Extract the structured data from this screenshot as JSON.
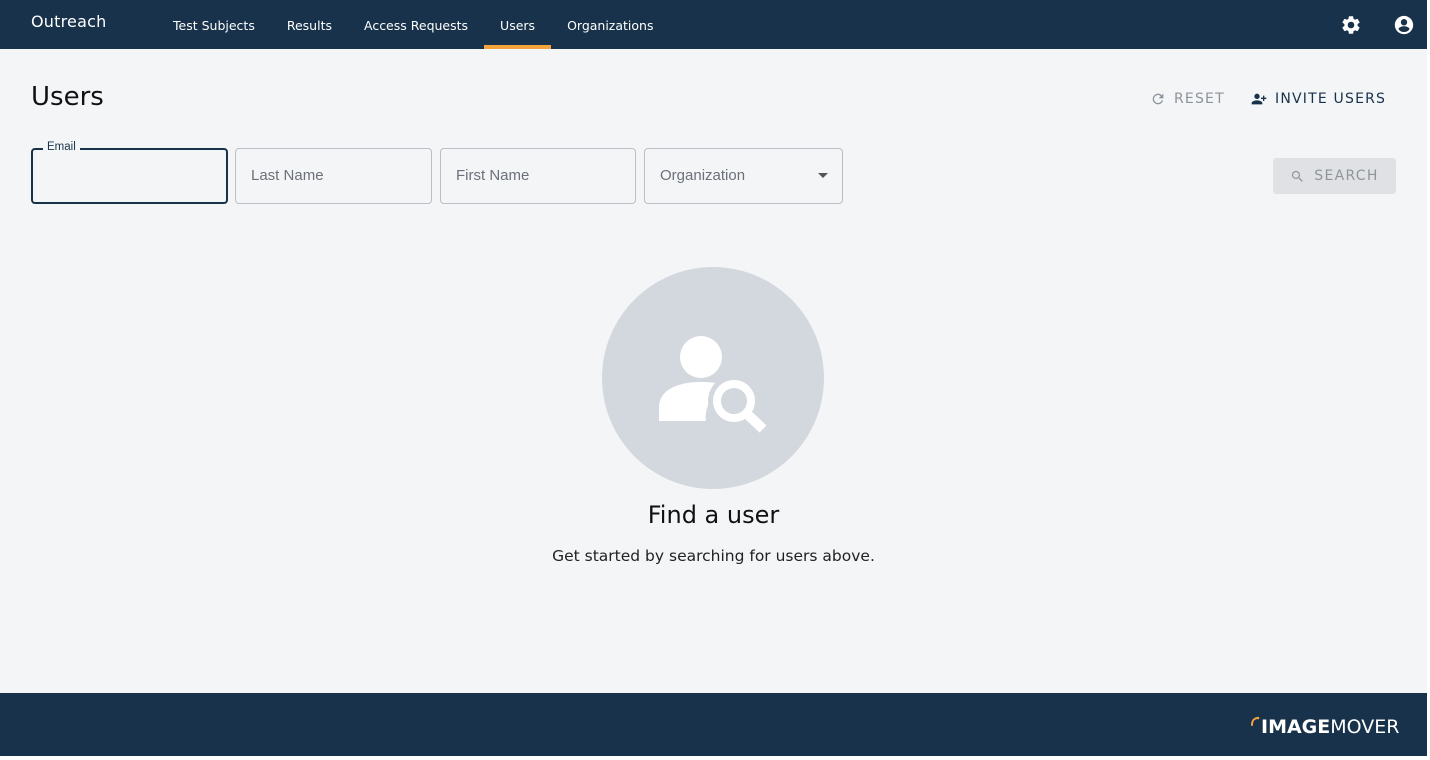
{
  "app": {
    "brand": "Outreach"
  },
  "nav": {
    "items": [
      {
        "label": "Test Subjects"
      },
      {
        "label": "Results"
      },
      {
        "label": "Access Requests"
      },
      {
        "label": "Users",
        "active": true
      },
      {
        "label": "Organizations"
      }
    ]
  },
  "icons": {
    "settings": "gear-icon",
    "account": "account-circle-icon"
  },
  "page": {
    "title": "Users",
    "reset_label": "RESET",
    "invite_label": "INVITE USERS"
  },
  "filters": {
    "email_label": "Email",
    "email_value": "",
    "last_name_placeholder": "Last Name",
    "first_name_placeholder": "First Name",
    "organization_placeholder": "Organization",
    "search_label": "SEARCH"
  },
  "empty_state": {
    "title": "Find a user",
    "subtitle": "Get started by searching for users above."
  },
  "footer": {
    "logo_bold": "IMAGE",
    "logo_light": "MOVER"
  },
  "colors": {
    "header_bg": "#17324a",
    "accent": "#f5a33b",
    "page_bg": "#f4f5f7",
    "empty_circle": "#d3d8de"
  }
}
